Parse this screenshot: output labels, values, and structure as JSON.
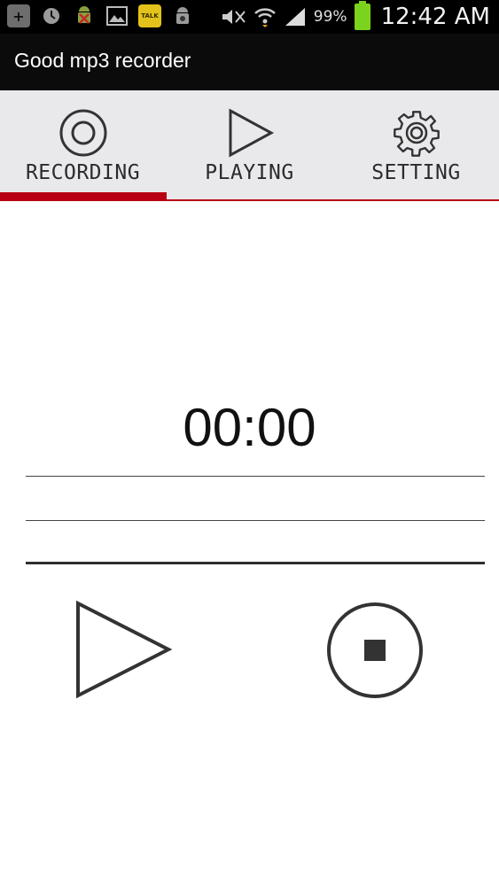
{
  "status_bar": {
    "notification_icons": [
      "add-icon",
      "clock-icon",
      "android-blocked-icon",
      "image-icon",
      "talk-icon",
      "android-debug-icon"
    ],
    "talk_badge": "TALK",
    "system_icons": [
      "mute-icon",
      "wifi-icon",
      "signal-icon"
    ],
    "battery_percent": "99%",
    "time": "12:42 AM",
    "colors": {
      "background": "#000000",
      "battery": "#7cd31e"
    }
  },
  "app": {
    "title": "Good mp3 recorder"
  },
  "tabs": [
    {
      "label": "RECORDING",
      "icon": "record-icon",
      "selected": true
    },
    {
      "label": "PLAYING",
      "icon": "play-icon",
      "selected": false
    },
    {
      "label": "SETTING",
      "icon": "gear-icon",
      "selected": false
    }
  ],
  "recorder": {
    "time": "00:00",
    "controls": [
      {
        "name": "play-button",
        "icon": "play-icon"
      },
      {
        "name": "stop-button",
        "icon": "stop-icon"
      }
    ]
  },
  "colors": {
    "accent": "#b80012",
    "tab_background": "#e9e9ec",
    "icon_stroke": "#333333"
  }
}
